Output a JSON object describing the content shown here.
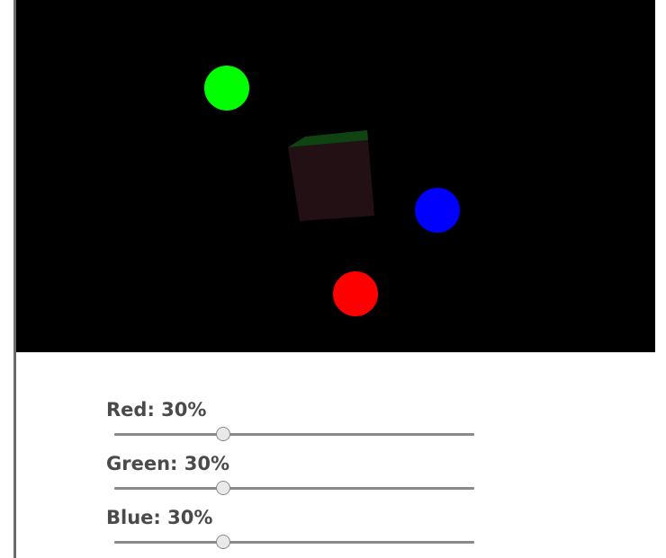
{
  "scene": {
    "background": "#000000",
    "cube_color": "#231015",
    "cube_top_color": "#0f4412",
    "lights": [
      {
        "name": "green-light",
        "color": "#00ff00"
      },
      {
        "name": "blue-light",
        "color": "#0000ff"
      },
      {
        "name": "red-light",
        "color": "#ff0000"
      }
    ]
  },
  "controls": [
    {
      "label": "Red: 30%",
      "value": 30,
      "min": 0,
      "max": 100
    },
    {
      "label": "Green: 30%",
      "value": 30,
      "min": 0,
      "max": 100
    },
    {
      "label": "Blue: 30%",
      "value": 30,
      "min": 0,
      "max": 100
    }
  ]
}
